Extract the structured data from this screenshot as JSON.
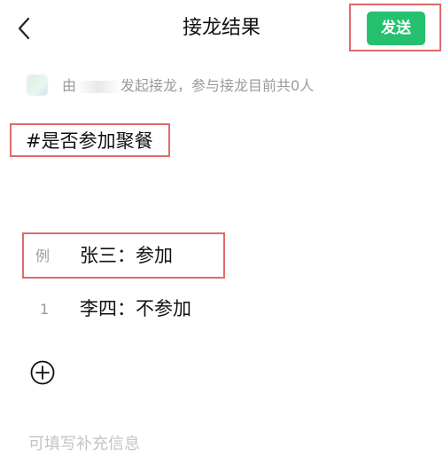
{
  "header": {
    "back_icon": "chevron-left-icon",
    "title": "接龙结果",
    "send_label": "发送",
    "send_color": "#25c16f"
  },
  "initiator": {
    "prefix": "由",
    "name_redacted": true,
    "suffix": "发起接龙，参与接龙目前共0人"
  },
  "topic": "#是否参加聚餐",
  "example": {
    "index_label": "例",
    "text": "张三：参加"
  },
  "entries": [
    {
      "index": "1",
      "text": "李四：不参加"
    }
  ],
  "add_icon": "plus-circle-icon",
  "supplement_placeholder": "可填写补充信息",
  "annotation_color": "#e06a6a"
}
